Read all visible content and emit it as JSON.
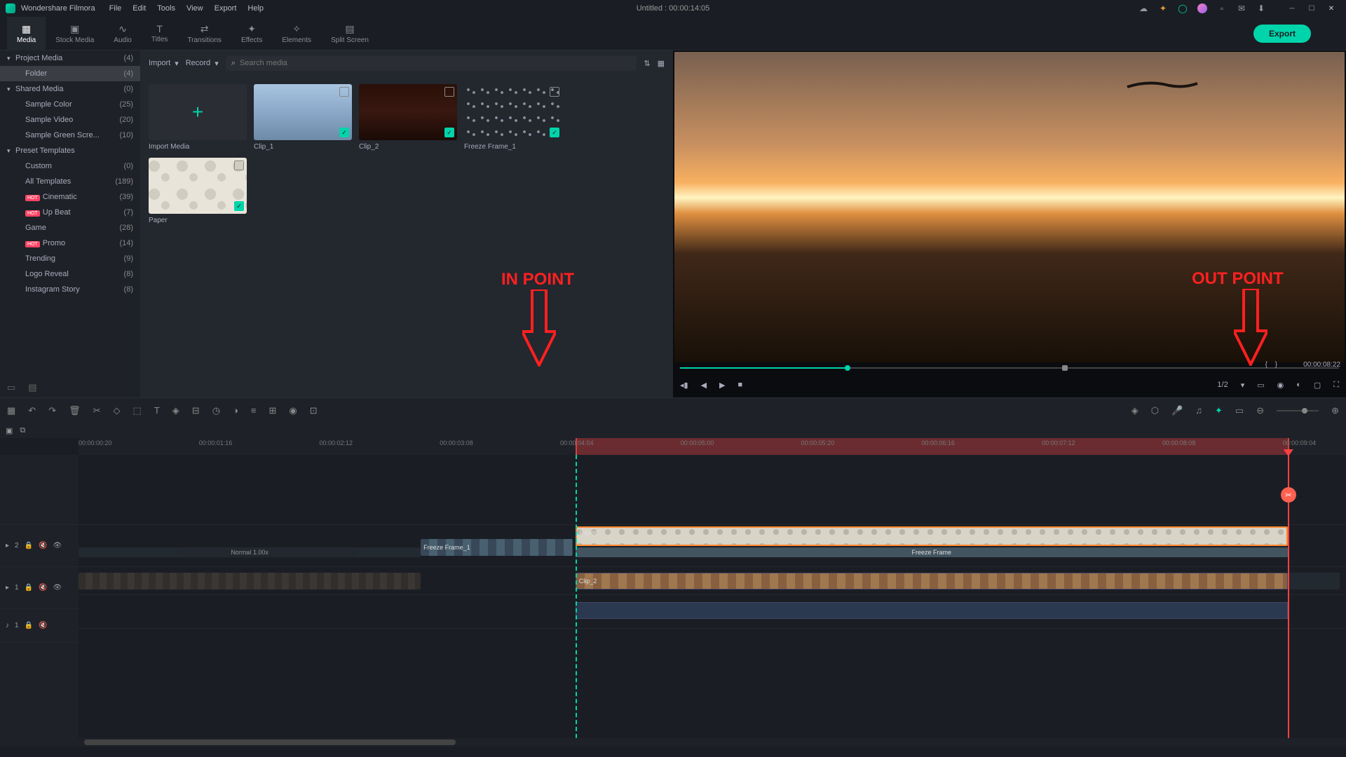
{
  "app": {
    "name": "Wondershare Filmora",
    "title": "Untitled : 00:00:14:05"
  },
  "menu": [
    "File",
    "Edit",
    "Tools",
    "View",
    "Export",
    "Help"
  ],
  "main_tabs": [
    {
      "label": "Media",
      "icon": "▦"
    },
    {
      "label": "Stock Media",
      "icon": "▣"
    },
    {
      "label": "Audio",
      "icon": "∿"
    },
    {
      "label": "Titles",
      "icon": "T"
    },
    {
      "label": "Transitions",
      "icon": "⇄"
    },
    {
      "label": "Effects",
      "icon": "✦"
    },
    {
      "label": "Elements",
      "icon": "✧"
    },
    {
      "label": "Split Screen",
      "icon": "▤"
    }
  ],
  "export_label": "Export",
  "sidebar": [
    {
      "label": "Project Media",
      "count": "(4)",
      "expandable": true,
      "level": 0
    },
    {
      "label": "Folder",
      "count": "(4)",
      "level": 1,
      "selected": true
    },
    {
      "label": "Shared Media",
      "count": "(0)",
      "expandable": true,
      "level": 0
    },
    {
      "label": "Sample Color",
      "count": "(25)",
      "level": 1
    },
    {
      "label": "Sample Video",
      "count": "(20)",
      "level": 1
    },
    {
      "label": "Sample Green Scre...",
      "count": "(10)",
      "level": 1
    },
    {
      "label": "Preset Templates",
      "count": "",
      "expandable": true,
      "level": 0
    },
    {
      "label": "Custom",
      "count": "(0)",
      "level": 1
    },
    {
      "label": "All Templates",
      "count": "(189)",
      "level": 1
    },
    {
      "label": "Cinematic",
      "count": "(39)",
      "level": 1,
      "hot": true
    },
    {
      "label": "Up Beat",
      "count": "(7)",
      "level": 1,
      "hot": true
    },
    {
      "label": "Game",
      "count": "(28)",
      "level": 1
    },
    {
      "label": "Promo",
      "count": "(14)",
      "level": 1,
      "hot": true
    },
    {
      "label": "Trending",
      "count": "(9)",
      "level": 1
    },
    {
      "label": "Logo Reveal",
      "count": "(8)",
      "level": 1
    },
    {
      "label": "Instagram Story",
      "count": "(8)",
      "level": 1
    }
  ],
  "media_toolbar": {
    "import": "Import",
    "record": "Record",
    "search_placeholder": "Search media"
  },
  "media_items": [
    {
      "label": "Import Media",
      "import": true
    },
    {
      "label": "Clip_1",
      "cls": "clip1-bg"
    },
    {
      "label": "Clip_2",
      "cls": "clip2-bg"
    },
    {
      "label": "Freeze Frame_1",
      "cls": "ff-bg"
    },
    {
      "label": "Paper",
      "cls": "paper-bg"
    }
  ],
  "player": {
    "zoom": "1/2",
    "timecode": "00:00:08:22",
    "mark_in": "{",
    "mark_out": "}"
  },
  "ruler_ticks": [
    "00:00:00:20",
    "00:00:01:16",
    "00:00:02:12",
    "00:00:03:08",
    "00:00:04:04",
    "00:00:05:00",
    "00:00:05:20",
    "00:00:06:16",
    "00:00:07:12",
    "00:00:08:08",
    "00:00:09:04"
  ],
  "tracks": {
    "t2_label": "2",
    "t1_label": "1",
    "a1_label": "1",
    "paper_label": "Paper",
    "ff_label": "Freeze Frame",
    "clip2_label": "Clip_2",
    "normal_label": "Normal 1.00x",
    "ff1_label": "Freeze Frame_1"
  },
  "annot": {
    "in": "IN POINT",
    "out": "OUT POINT"
  }
}
